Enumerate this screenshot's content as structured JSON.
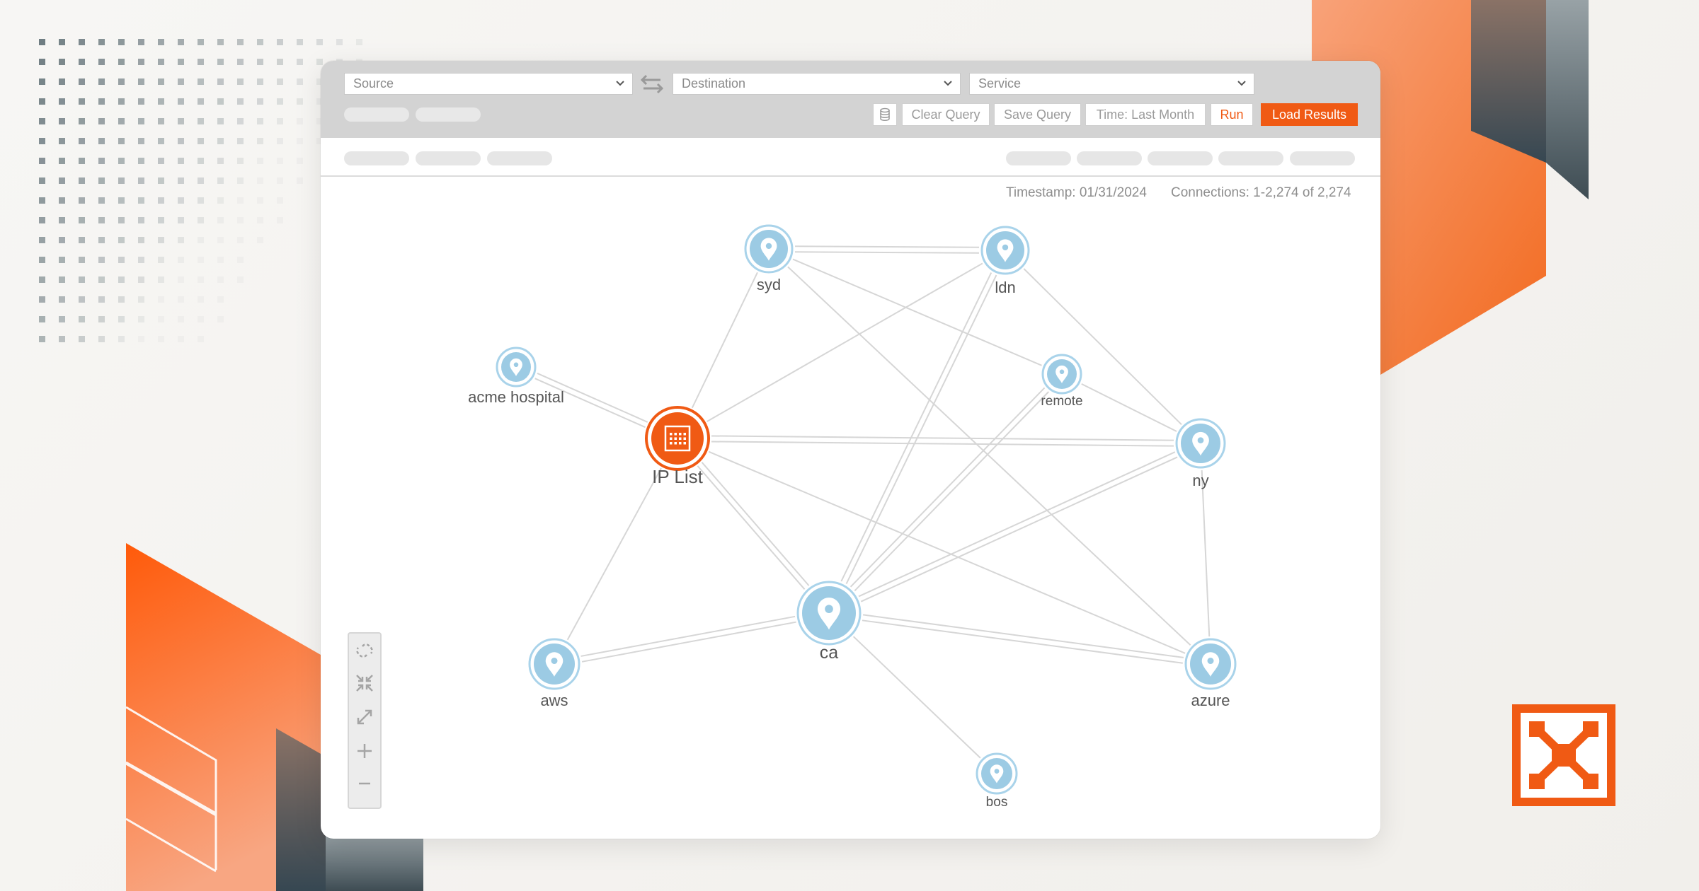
{
  "query": {
    "source_placeholder": "Source",
    "destination_placeholder": "Destination",
    "service_placeholder": "Service"
  },
  "toolbar": {
    "clear_query": "Clear Query",
    "save_query": "Save Query",
    "time_range": "Time: Last Month",
    "run": "Run",
    "load_results": "Load Results"
  },
  "stats": {
    "timestamp": "Timestamp: 01/31/2024",
    "connections": "Connections: 1-2,274 of 2,274"
  },
  "graph": {
    "nodes": {
      "syd": "syd",
      "ldn": "ldn",
      "acme_hospital": "acme hospital",
      "ip_list": "IP List",
      "remote": "remote",
      "ny": "ny",
      "ca": "ca",
      "aws": "aws",
      "azure": "azure",
      "bos": "bos"
    }
  },
  "colors": {
    "accent": "#f05a14",
    "node_fill": "#9ccbe4",
    "node_ring": "#a9d3ea",
    "edge": "#d6d6d6",
    "toolbar_bg": "#d3d3d3"
  },
  "icons": {
    "location": "map-pin-icon",
    "ip_list": "grid-list-icon",
    "zoom_controls": [
      "unlink-icon",
      "collapse-icon",
      "expand-icon",
      "zoom-in-icon",
      "zoom-out-icon"
    ]
  }
}
